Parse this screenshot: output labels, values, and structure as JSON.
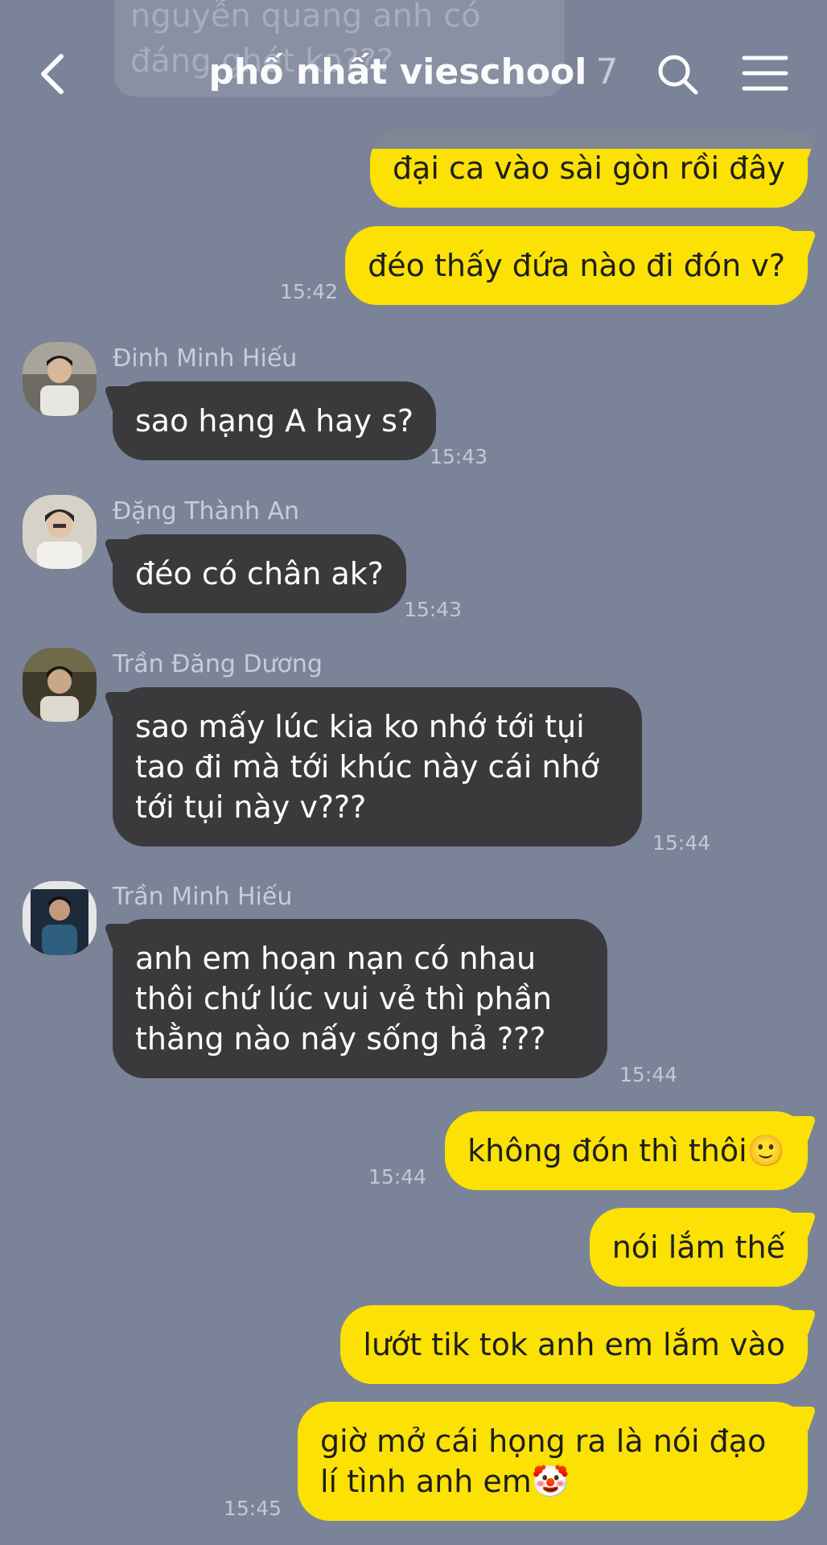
{
  "header": {
    "title": "phố nhất vieschool",
    "member_count": "7",
    "peek_text": "nguyễn quang anh có đáng ghét ko???"
  },
  "messages": {
    "m1": "đại ca vào sài gòn rồi đây",
    "m2": "đéo thấy đứa nào đi đón v?",
    "t2": "15:42",
    "s3": "Đinh Minh Hiếu",
    "m3": "sao hạng A hay s?",
    "t3": "15:43",
    "s4": "Đặng Thành An",
    "m4": "đéo có chân ak?",
    "t4": "15:43",
    "s5": "Trần Đăng Dương",
    "m5": "sao mấy lúc kia ko nhớ tới tụi tao đi mà tới khúc này cái nhớ tới tụi này v???",
    "t5": "15:44",
    "s6": "Trần Minh Hiếu",
    "m6": "anh em hoạn nạn có nhau thôi chứ lúc vui vẻ thì phần thằng nào nấy sống hả ???",
    "t6": "15:44",
    "m7": "không đón thì thôi🙂",
    "t7": "15:44",
    "m8": "nói lắm thế",
    "m9": "lướt tik tok anh em lắm vào",
    "m10": "giờ mở cái họng ra là nói đạo lí tình anh em🤡",
    "t10": "15:45"
  },
  "icons": {
    "back": "chevron-left-icon",
    "search": "search-icon",
    "menu": "hamburger-menu-icon"
  },
  "colors": {
    "background": "#7b8399",
    "outgoing_bubble": "#fbe104",
    "incoming_bubble": "#3a3a3c"
  }
}
